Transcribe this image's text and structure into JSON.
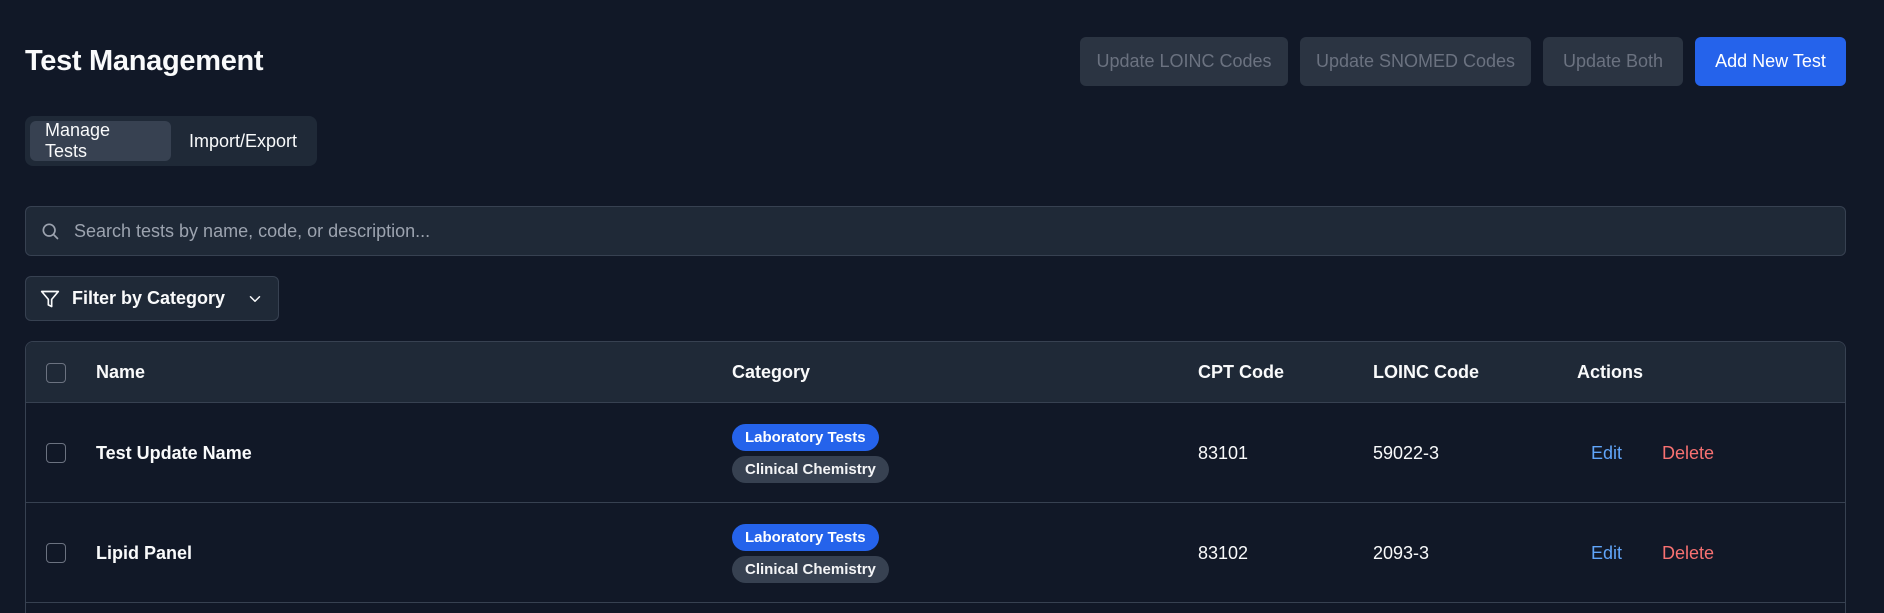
{
  "header": {
    "title": "Test Management",
    "buttons": {
      "update_loinc": "Update LOINC Codes",
      "update_snomed": "Update SNOMED Codes",
      "update_both": "Update Both",
      "add_new": "Add New Test"
    }
  },
  "tabs": [
    {
      "label": "Manage Tests",
      "active": true
    },
    {
      "label": "Import/Export",
      "active": false
    }
  ],
  "search": {
    "placeholder": "Search tests by name, code, or description...",
    "value": ""
  },
  "filter": {
    "label": "Filter by Category"
  },
  "table": {
    "columns": [
      "Name",
      "Category",
      "CPT Code",
      "LOINC Code",
      "Actions"
    ],
    "rows": [
      {
        "name": "Test Update Name",
        "categories": [
          "Laboratory Tests",
          "Clinical Chemistry"
        ],
        "cpt": "83101",
        "loinc": "59022-3",
        "edit": "Edit",
        "delete": "Delete"
      },
      {
        "name": "Lipid Panel",
        "categories": [
          "Laboratory Tests",
          "Clinical Chemistry"
        ],
        "cpt": "83102",
        "loinc": "2093-3",
        "edit": "Edit",
        "delete": "Delete"
      }
    ]
  },
  "icons": {
    "search": "search-icon",
    "filter": "filter-icon",
    "dropdown": "chevron-down-icon"
  },
  "colors": {
    "background": "#111827",
    "surface": "#1f2937",
    "primary": "#2563eb",
    "edit_link": "#60a5fa",
    "delete_link": "#f87171"
  }
}
